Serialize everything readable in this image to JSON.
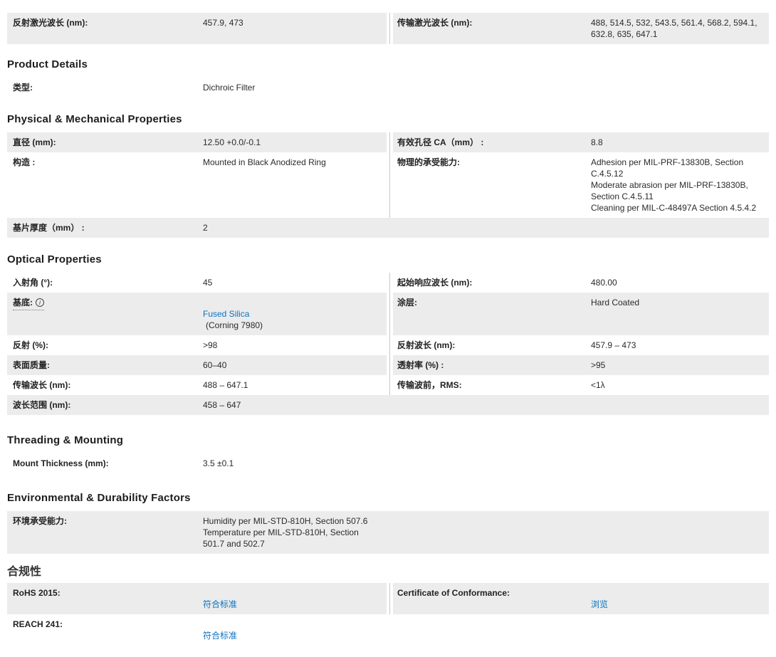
{
  "colors": {
    "row_gray": "#ececec",
    "divider": "#c8c8c8",
    "link_blue": "#0a72c2",
    "text": "#2b2b2b"
  },
  "top_table": {
    "left_label": "反射激光波长 (nm):",
    "left_value": "457.9, 473",
    "right_label": "传输激光波长 (nm):",
    "right_value": "488, 514.5, 532, 543.5, 561.4, 568.2, 594.1, 632.8, 635, 647.1"
  },
  "product_details": {
    "heading": "Product Details",
    "type": {
      "label": "类型:",
      "value": "Dichroic Filter"
    }
  },
  "physical": {
    "heading": "Physical & Mechanical Properties",
    "diameter": {
      "label": "直径 (mm):",
      "value": "12.50 +0.0/-0.1"
    },
    "clear_aperture": {
      "label": "有效孔径 CA（mm） :",
      "value": "8.8"
    },
    "construction": {
      "label": "构造 :",
      "value": "Mounted in Black Anodized Ring"
    },
    "physical_durability": {
      "label": "物理的承受能力:",
      "value": "Adhesion per MIL-PRF-13830B, Section C.4.5.12\nModerate abrasion per MIL-PRF-13830B, Section C.4.5.11\nCleaning per MIL-C-48497A Section 4.5.4.2"
    },
    "substrate_thickness": {
      "label": "基片厚度（mm） :",
      "value": "2"
    }
  },
  "optical": {
    "heading": "Optical Properties",
    "angle_of_incidence": {
      "label": "入射角 (°):",
      "value": "45"
    },
    "cut_on_wavelength": {
      "label": "起始响应波长 (nm):",
      "value": "480.00"
    },
    "substrate": {
      "label": "基底:",
      "icon": "info-icon",
      "value_link": "Fused Silica",
      "value_rest": "(Corning 7980)"
    },
    "coating": {
      "label": "涂层:",
      "value": "Hard Coated"
    },
    "reflection": {
      "label": "反射 (%):",
      "value": ">98"
    },
    "reflection_wavelength": {
      "label": "反射波长 (nm):",
      "value": "457.9 – 473"
    },
    "surface_quality": {
      "label": "表面质量:",
      "value": "60–40"
    },
    "transmission": {
      "label": "透射率 (%) :",
      "value": ">95"
    },
    "transmission_wavelength": {
      "label": "传输波长 (nm):",
      "value": "488 – 647.1"
    },
    "transmitted_wavefront": {
      "label": "传输波前，RMS:",
      "value": "<1λ"
    },
    "wavelength_range": {
      "label": "波长范围 (nm):",
      "value": "458 – 647"
    }
  },
  "threading": {
    "heading": "Threading & Mounting",
    "mount_thickness": {
      "label": "Mount Thickness (mm):",
      "value": "3.5 ±0.1"
    }
  },
  "environmental": {
    "heading": "Environmental & Durability Factors",
    "environmental_durability": {
      "label": "环境承受能力:",
      "value": "Humidity per MIL-STD-810H, Section 507.6\nTemperature per MIL-STD-810H, Section 501.7 and 502.7"
    }
  },
  "compliance": {
    "heading": "合规性",
    "rohs": {
      "label": "RoHS 2015:",
      "link": "符合标准"
    },
    "certificate": {
      "label": "Certificate of Conformance:",
      "link": "浏览"
    },
    "reach": {
      "label": "REACH 241:",
      "link": "符合标准"
    }
  }
}
